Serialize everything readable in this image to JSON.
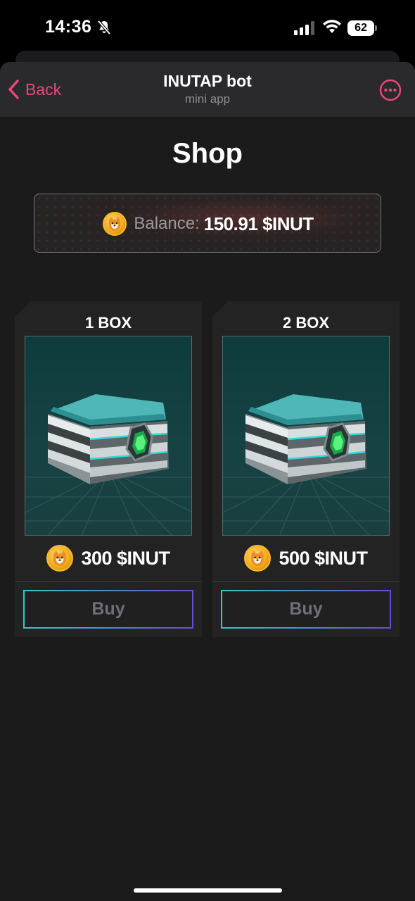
{
  "status_bar": {
    "time": "14:36",
    "battery_percent": "62",
    "icons": [
      "bell-muted-icon",
      "signal-icon",
      "wifi-icon",
      "battery-icon"
    ]
  },
  "header": {
    "back_label": "Back",
    "title": "INUTAP bot",
    "subtitle": "mini app",
    "more_icon": "ellipsis-circle-icon"
  },
  "page": {
    "title": "Shop"
  },
  "balance": {
    "label": "Balance:",
    "value": "150.91 $INUT",
    "icon": "inu-coin-icon"
  },
  "products": [
    {
      "title": "1 BOX",
      "price": "300 $INUT",
      "buy_label": "Buy",
      "image": "cyber-box"
    },
    {
      "title": "2 BOX",
      "price": "500 $INUT",
      "buy_label": "Buy",
      "image": "cyber-box"
    }
  ],
  "colors": {
    "accent_pink": "#e8487a",
    "background": "#1b1b1b",
    "coin_gold": "#f0a818",
    "box_teal": "#164244",
    "buy_gradient_start": "#2ad0c0",
    "buy_gradient_end": "#6a4bd8"
  }
}
